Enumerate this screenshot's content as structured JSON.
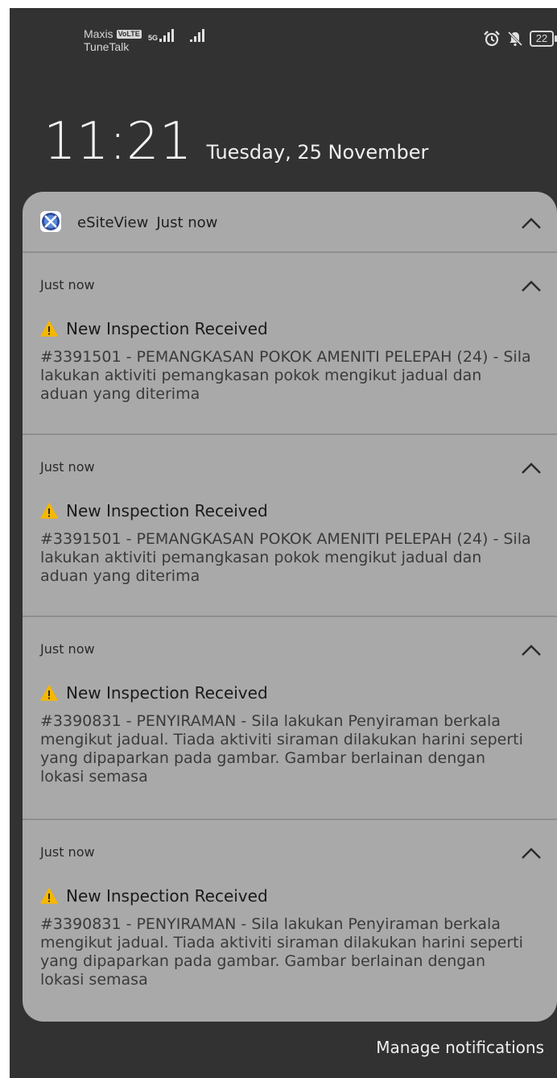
{
  "status_bar": {
    "carrier_1": "Maxis",
    "carrier_1_badge": "VoLTE",
    "carrier_2": "TuneTalk",
    "network_type": "5G",
    "battery_level": "22",
    "icons": [
      "signal-icon",
      "alarm-icon",
      "mute-icon",
      "battery-icon"
    ]
  },
  "lockscreen": {
    "time": "11:21",
    "date": "Tuesday, 25 November"
  },
  "notification_group": {
    "app_name": "eSiteView",
    "app_time": "Just now",
    "notifications": [
      {
        "time": "Just now",
        "title": "New Inspection Received",
        "body": "#3391501 - PEMANGKASAN POKOK AMENITI PELEPAH (24) - Sila lakukan aktiviti pemangkasan pokok mengikut jadual dan aduan yang diterima"
      },
      {
        "time": "Just now",
        "title": "New Inspection Received",
        "body": "#3391501 - PEMANGKASAN POKOK AMENITI PELEPAH (24) - Sila lakukan aktiviti pemangkasan pokok mengikut jadual dan aduan yang diterima"
      },
      {
        "time": "Just now",
        "title": "New Inspection Received",
        "body": "#3390831 - PENYIRAMAN - Sila lakukan Penyiraman berkala mengikut jadual. Tiada aktiviti siraman dilakukan harini seperti yang dipaparkan pada gambar. Gambar berlainan dengan lokasi semasa"
      },
      {
        "time": "Just now",
        "title": "New Inspection Received",
        "body": "#3390831 - PENYIRAMAN - Sila lakukan Penyiraman berkala mengikut jadual. Tiada aktiviti siraman dilakukan harini seperti yang dipaparkan pada gambar. Gambar berlainan dengan lokasi semasa"
      }
    ]
  },
  "footer": {
    "manage_label": "Manage notifications"
  },
  "colors": {
    "background": "#323232",
    "card": "#a9a9a9",
    "warning": "#f5b700"
  }
}
